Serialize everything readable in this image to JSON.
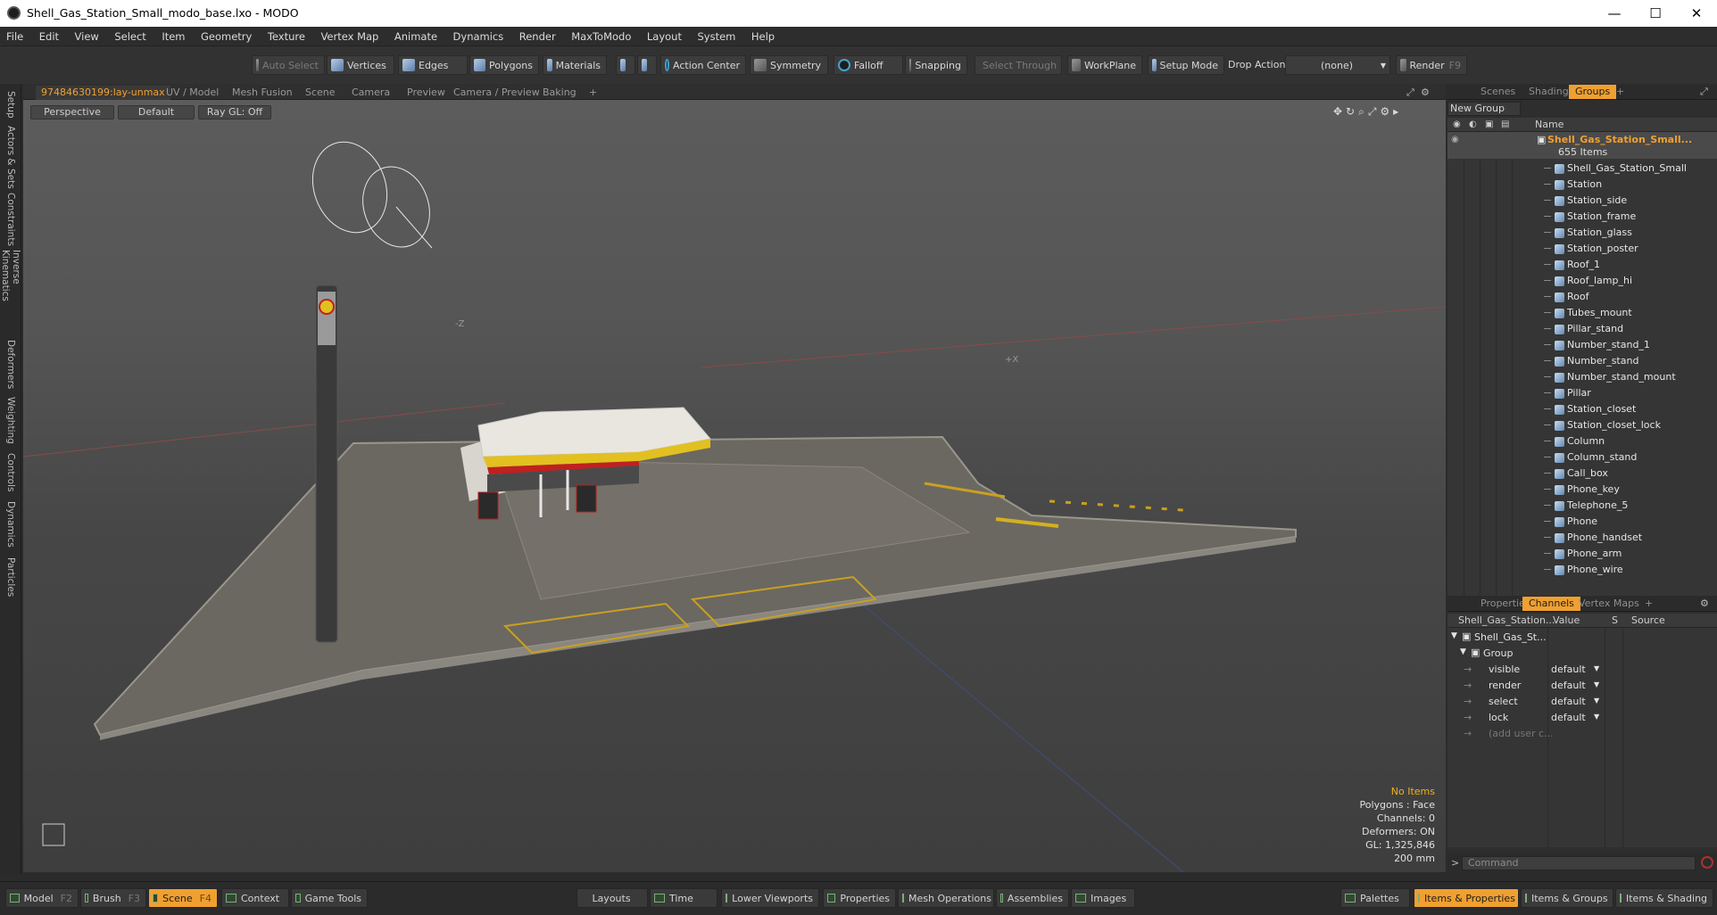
{
  "window": {
    "title": "Shell_Gas_Station_Small_modo_base.lxo - MODO",
    "minimize": "—",
    "maximize": "☐",
    "close": "✕"
  },
  "menu": [
    "File",
    "Edit",
    "View",
    "Select",
    "Item",
    "Geometry",
    "Texture",
    "Vertex Map",
    "Animate",
    "Dynamics",
    "Render",
    "MaxToModo",
    "Layout",
    "System",
    "Help"
  ],
  "toolbar": {
    "auto_select": "Auto Select",
    "vertices": "Vertices",
    "edges": "Edges",
    "polygons": "Polygons",
    "materials": "Materials",
    "action_center": "Action Center",
    "symmetry": "Symmetry",
    "falloff": "Falloff",
    "snapping": "Snapping",
    "select_through": "Select Through",
    "workplane": "WorkPlane",
    "setup_mode": "Setup Mode",
    "drop_action_label": "Drop Action",
    "drop_action_value": "(none)",
    "render": "Render",
    "render_key": "F9"
  },
  "left_tabs": [
    "Setup",
    "Actors & Sets",
    "Constraints",
    "Inverse Kinematics",
    "Deformers",
    "Weighting",
    "Controls",
    "Dynamics",
    "Particles"
  ],
  "viewport_tabs": [
    "97484630199:lay-unmax",
    "UV / Model",
    "Mesh Fusion",
    "Scene",
    "Camera",
    "Preview",
    "Camera / Preview",
    "Baking",
    "+"
  ],
  "viewport": {
    "view_mode": "Perspective",
    "shading": "Default",
    "raygl": "Ray GL: Off",
    "info": {
      "items": "No Items",
      "polygons": "Polygons : Face",
      "channels": "Channels: 0",
      "deformers": "Deformers: ON",
      "gl": "GL: 1,325,846",
      "scale": "200 mm"
    },
    "axis_x": "+X",
    "axis_z": "-Z"
  },
  "right_tabs": [
    "Scenes",
    "Shading",
    "Groups",
    "+"
  ],
  "groups": {
    "new_group": "New Group",
    "name_header": "Name",
    "root": {
      "name": "Shell_Gas_Station_Small...",
      "count": "655 Items"
    },
    "items": [
      "Shell_Gas_Station_Small",
      "Station",
      "Station_side",
      "Station_frame",
      "Station_glass",
      "Station_poster",
      "Roof_1",
      "Roof_lamp_hi",
      "Roof",
      "Tubes_mount",
      "Pillar_stand",
      "Number_stand_1",
      "Number_stand",
      "Number_stand_mount",
      "Pillar",
      "Station_closet",
      "Station_closet_lock",
      "Column",
      "Column_stand",
      "Call_box",
      "Phone_key",
      "Telephone_5",
      "Phone",
      "Phone_handset",
      "Phone_arm",
      "Phone_wire"
    ]
  },
  "props_tabs": [
    "Properties",
    "Channels",
    "Vertex Maps",
    "+"
  ],
  "channels": {
    "headers": {
      "name": "Shell_Gas_Station...",
      "value": "Value",
      "s": "S",
      "source": "Source"
    },
    "root": "Shell_Gas_St...",
    "group": "Group",
    "rows": [
      {
        "name": "visible",
        "value": "default"
      },
      {
        "name": "render",
        "value": "default"
      },
      {
        "name": "select",
        "value": "default"
      },
      {
        "name": "lock",
        "value": "default"
      }
    ],
    "add_user": "(add user c..."
  },
  "command": {
    "prompt": ">",
    "placeholder": "Command"
  },
  "bottom": {
    "model": "Model",
    "model_key": "F2",
    "brush": "Brush",
    "brush_key": "F3",
    "scene": "Scene",
    "scene_key": "F4",
    "context": "Context",
    "game_tools": "Game Tools",
    "layouts": "Layouts",
    "time": "Time",
    "lower_viewports": "Lower Viewports",
    "properties": "Properties",
    "mesh_operations": "Mesh Operations",
    "assemblies": "Assemblies",
    "images": "Images",
    "palettes": "Palettes",
    "items_properties": "Items & Properties",
    "items_groups": "Items & Groups",
    "items_shading": "Items & Shading"
  }
}
